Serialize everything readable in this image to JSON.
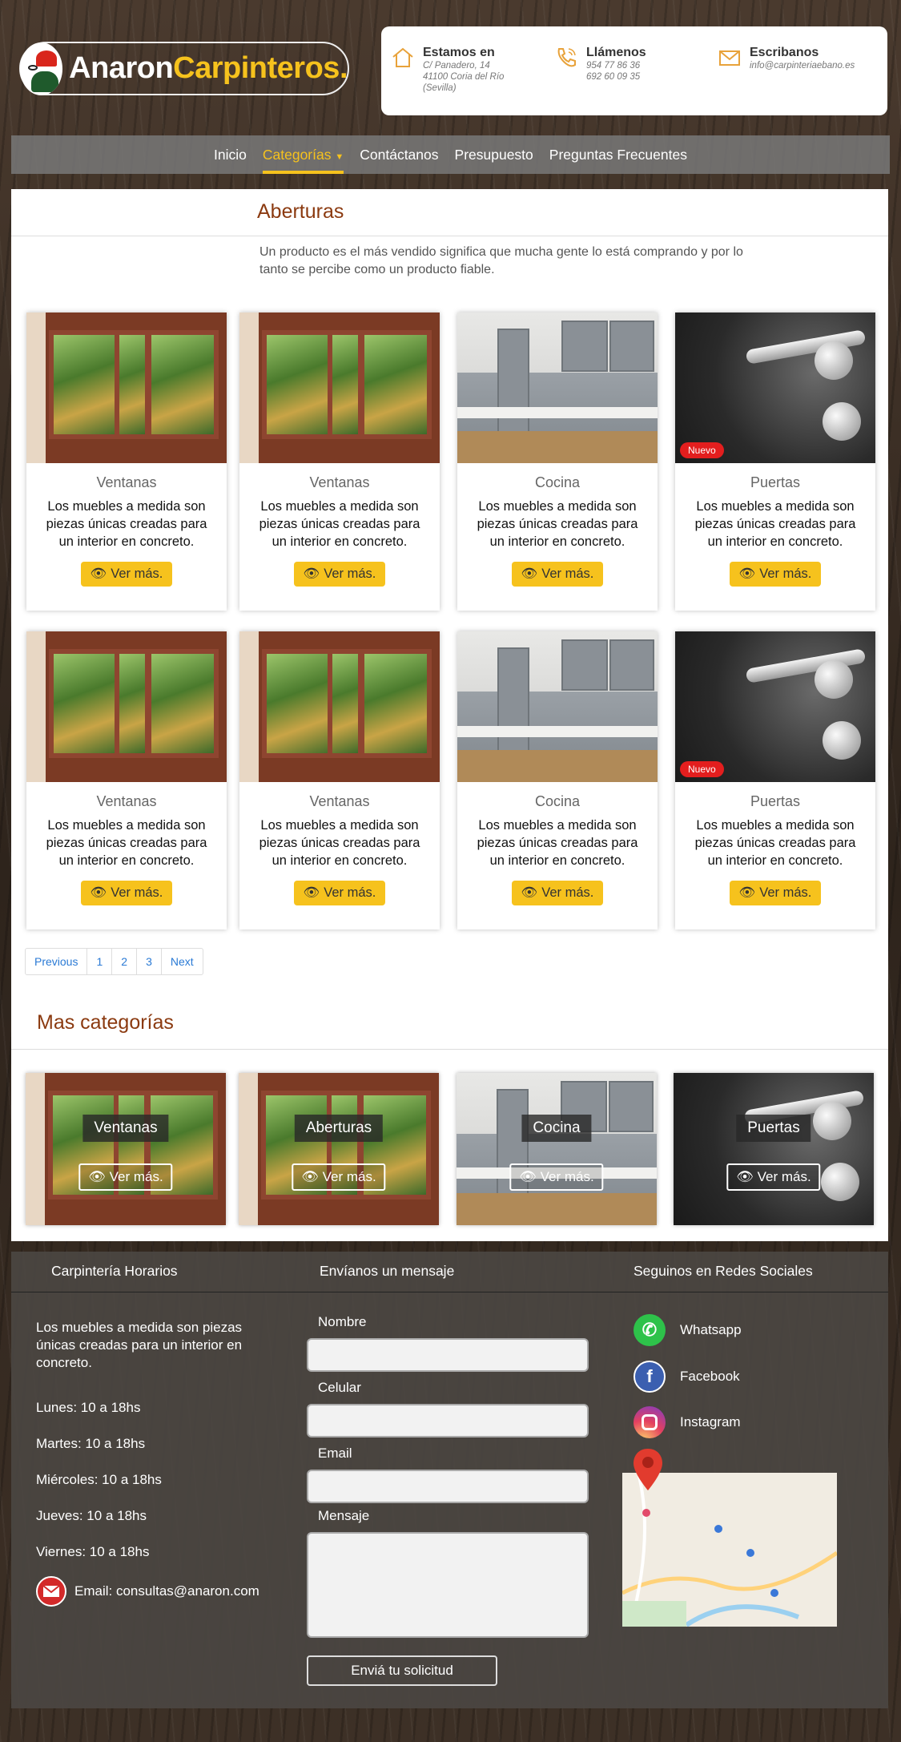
{
  "brand": {
    "name_part1": "Anaron",
    "name_part2": "Carpinteros."
  },
  "contact": {
    "address_title": "Estamos en",
    "address_line1": "C/ Panadero, 14",
    "address_line2": "41100 Coria del Río",
    "address_line3": "(Sevilla)",
    "phone_title": "Llámenos",
    "phone1": "954 77 86 36",
    "phone2": "692 60 09 35",
    "email_title": "Escribanos",
    "email": "info@carpinteriaebano.es"
  },
  "nav": {
    "items": [
      "Inicio",
      "Categorías",
      "Contáctanos",
      "Presupuesto",
      "Preguntas Frecuentes"
    ],
    "active": "Categorías"
  },
  "section": {
    "title": "Aberturas",
    "description_line1": "Un producto es el más vendido significa que mucha gente lo está comprando y por lo",
    "description_line2": "tanto se percibe como un producto fiable."
  },
  "products": [
    {
      "title": "Ventanas",
      "desc": "Los muebles a medida son piezas únicas creadas para un interior en concreto.",
      "button": "Ver más.",
      "image": "window",
      "badge": ""
    },
    {
      "title": "Ventanas",
      "desc": "Los muebles a medida son piezas únicas creadas para un interior en concreto.",
      "button": "Ver más.",
      "image": "window",
      "badge": ""
    },
    {
      "title": "Cocina",
      "desc": "Los muebles a medida son piezas únicas creadas para un interior en concreto.",
      "button": "Ver más.",
      "image": "kitchen",
      "badge": ""
    },
    {
      "title": "Puertas",
      "desc": "Los muebles a medida son piezas únicas creadas para un interior en concreto.",
      "button": "Ver más.",
      "image": "door",
      "badge": "Nuevo"
    },
    {
      "title": "Ventanas",
      "desc": "Los muebles a medida son piezas únicas creadas para un interior en concreto.",
      "button": "Ver más.",
      "image": "window",
      "badge": ""
    },
    {
      "title": "Ventanas",
      "desc": "Los muebles a medida son piezas únicas creadas para un interior en concreto.",
      "button": "Ver más.",
      "image": "window",
      "badge": ""
    },
    {
      "title": "Cocina",
      "desc": "Los muebles a medida son piezas únicas creadas para un interior en concreto.",
      "button": "Ver más.",
      "image": "kitchen",
      "badge": ""
    },
    {
      "title": "Puertas",
      "desc": "Los muebles a medida son piezas únicas creadas para un interior en concreto.",
      "button": "Ver más.",
      "image": "door",
      "badge": "Nuevo"
    }
  ],
  "pagination": {
    "prev": "Previous",
    "pages": [
      "1",
      "2",
      "3"
    ],
    "next": "Next"
  },
  "more_categories": {
    "title": "Mas categorías",
    "items": [
      {
        "label": "Ventanas",
        "button": "Ver más.",
        "image": "window"
      },
      {
        "label": "Aberturas",
        "button": "Ver más.",
        "image": "window"
      },
      {
        "label": "Cocina",
        "button": "Ver más.",
        "image": "kitchen"
      },
      {
        "label": "Puertas",
        "button": "Ver más.",
        "image": "door"
      }
    ]
  },
  "footer": {
    "col1_title": "Carpintería Horarios",
    "col2_title": "Envíanos un mensaje",
    "col3_title": "Seguinos en Redes Sociales",
    "about_line1": "Los muebles a medida son piezas",
    "about_line2": "únicas creadas para un interior en",
    "about_line3": "concreto.",
    "hours": [
      "Lunes: 10 a 18hs",
      "Martes: 10 a 18hs",
      "Miércoles: 10 a 18hs",
      "Jueves: 10 a 18hs",
      "Viernes: 10 a 18hs"
    ],
    "email": "Email: consultas@anaron.com",
    "form": {
      "name_label": "Nombre",
      "phone_label": "Celular",
      "email_label": "Email",
      "message_label": "Mensaje",
      "submit": "Enviá tu solicitud"
    },
    "social": [
      "Whatsapp",
      "Facebook",
      "Instagram"
    ]
  },
  "colors": {
    "accent": "#f6c21d",
    "title_brown": "#8b3a10",
    "badge_red": "#e31e1e",
    "link_blue": "#2a7ad5"
  }
}
